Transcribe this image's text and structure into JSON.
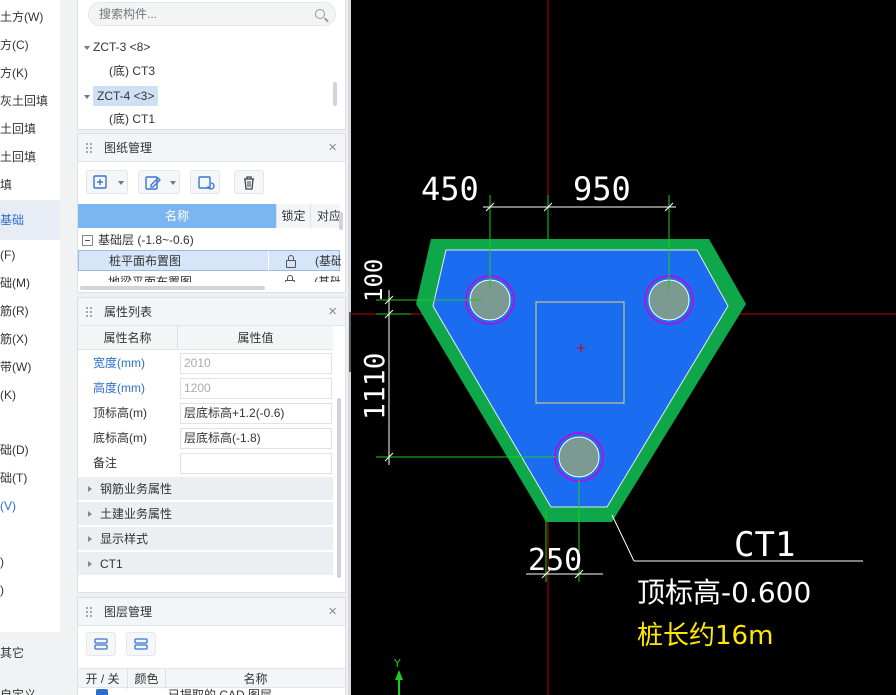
{
  "left_nav": {
    "items": [
      "土方(W)",
      "方(C)",
      "方(K)",
      "灰土回填",
      "土回填",
      "土回填",
      "填",
      "基础",
      "(F)",
      "础(M)",
      "筋(R)",
      "筋(X)",
      "带(W)",
      "(K)",
      "础(D)",
      "础(T)",
      "(V)",
      ")",
      ")"
    ],
    "selected": "基础",
    "footer_items": [
      "其它",
      "自定义"
    ]
  },
  "component_tree": {
    "search_placeholder": "搜索构件...",
    "items": [
      {
        "label": "ZCT-3 <8>",
        "child": "(底) CT3"
      },
      {
        "label": "ZCT-4 <3>",
        "child": "(底) CT1"
      }
    ],
    "selected": "ZCT-4 <3>"
  },
  "drawing_panel": {
    "title": "图纸管理",
    "columns": [
      "名称",
      "锁定",
      "对应"
    ],
    "group": "基础层 (-1.8~-0.6)",
    "rows": [
      {
        "name": "桩平面布置图",
        "extra": "(基础"
      },
      {
        "name": "地梁平面布置图",
        "extra": "(基础"
      }
    ]
  },
  "property_panel": {
    "title": "属性列表",
    "columns": [
      "属性名称",
      "属性值"
    ],
    "rows": [
      {
        "key": "宽度(mm)",
        "value": "2010"
      },
      {
        "key": "高度(mm)",
        "value": "1200"
      },
      {
        "key": "顶标高(m)",
        "value": "层底标高+1.2(-0.6)"
      },
      {
        "key": "底标高(m)",
        "value": "层底标高(-1.8)"
      },
      {
        "key": "备注",
        "value": ""
      }
    ],
    "groups": [
      "钢筋业务属性",
      "土建业务属性",
      "显示样式",
      "CT1"
    ]
  },
  "layer_panel": {
    "title": "图层管理",
    "columns": [
      "开 / 关",
      "颜色",
      "名称"
    ],
    "first_row": "已提取的 CAD 图层"
  },
  "cad": {
    "dim_450": "450",
    "dim_950": "950",
    "dim_100": "100",
    "dim_1110": "1110",
    "dim_250": "250",
    "cap_label": "CT1",
    "top_elevation": "顶标高-0.600",
    "pile_length": "桩长约16m",
    "axis_y": "Y",
    "colors": {
      "slab": "#1a6cf0",
      "border": "#0ea84a",
      "dimension": "#ffffff",
      "axis": "#d10000",
      "note": "#ffe800"
    }
  }
}
